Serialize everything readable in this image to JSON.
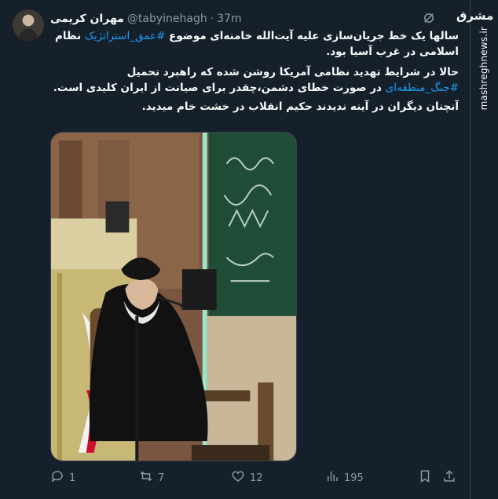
{
  "author": {
    "name": "مهران کریمی",
    "handle": "@tabyinehagh",
    "separator": "·",
    "time": "37m"
  },
  "watermark": {
    "logo": "مشرق",
    "url": "mashreghnews.ir"
  },
  "tweet": {
    "p1_before": "سالها یک خط جریان‌سازی علیه آیت‌الله خامنه‌ای موضوع ",
    "p1_hashtag": "#عمق_استراتژیک",
    "p1_after": " نظام اسلامی در غرب آسیا بود.",
    "p2_before": "حالا در شرایط تهدید نظامی آمریکا روشن شده که راهبرد تحمیل ",
    "p2_hashtag": "#جنگ_منطقه‌ای",
    "p2_after": " در صورت خطای دشمن،چقدر برای صیانت از ایران کلیدی است.",
    "p3": "آنچنان دیگران در آینه ندیدند حکیم انقلاب در خشت خام میدید."
  },
  "actions": {
    "replies": "1",
    "retweets": "7",
    "likes": "12",
    "views": "195"
  },
  "colors": {
    "background": "#15202b",
    "text": "#f7f9f9",
    "muted": "#8b98a5",
    "accent": "#1d9bf0",
    "border": "#38444d"
  },
  "icons": [
    "grok-icon",
    "reply-icon",
    "retweet-icon",
    "like-icon",
    "views-icon",
    "bookmark-icon",
    "share-icon"
  ]
}
